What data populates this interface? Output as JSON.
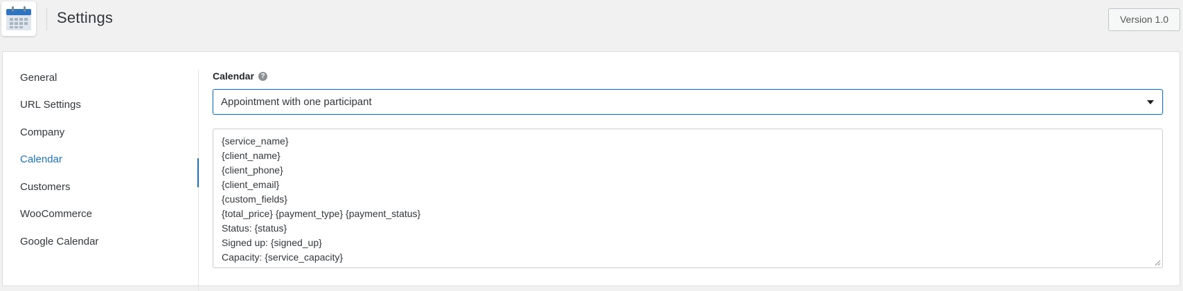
{
  "header": {
    "title": "Settings",
    "version_label": "Version 1.0",
    "app_icon": "calendar-icon"
  },
  "sidebar": {
    "items": [
      {
        "label": "General"
      },
      {
        "label": "URL Settings"
      },
      {
        "label": "Company"
      },
      {
        "label": "Calendar",
        "active": true
      },
      {
        "label": "Customers"
      },
      {
        "label": "WooCommerce"
      },
      {
        "label": "Google Calendar"
      }
    ]
  },
  "calendar_section": {
    "label": "Calendar",
    "help_icon": "question-circle-icon",
    "select_value": "Appointment with one participant",
    "template_lines": [
      "{service_name}",
      "{client_name}",
      "{client_phone}",
      "{client_email}",
      "{custom_fields}",
      "{total_price} {payment_type} {payment_status}",
      "Status: {status}",
      "Signed up: {signed_up}",
      "Capacity: {service_capacity}"
    ]
  },
  "colors": {
    "accent": "#1a73c9",
    "background": "#f1f1f1",
    "panel": "#ffffff"
  }
}
